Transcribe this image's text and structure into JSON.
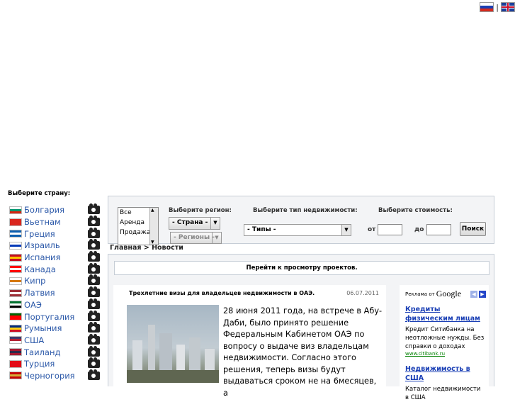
{
  "lang": {
    "ru": "RU",
    "separator": "|",
    "en": "EN"
  },
  "sidebar": {
    "heading": "Выберите страну:",
    "countries": [
      {
        "name": "Болгария",
        "colors": [
          "#ffffff",
          "#00966e",
          "#d62612"
        ]
      },
      {
        "name": "Вьетнам",
        "colors": [
          "#da251d",
          "#da251d",
          "#da251d"
        ]
      },
      {
        "name": "Греция",
        "colors": [
          "#0d5eaf",
          "#ffffff",
          "#0d5eaf"
        ]
      },
      {
        "name": "Израиль",
        "colors": [
          "#ffffff",
          "#0038b8",
          "#ffffff"
        ]
      },
      {
        "name": "Испания",
        "colors": [
          "#c60b1e",
          "#ffc400",
          "#c60b1e"
        ]
      },
      {
        "name": "Канада",
        "colors": [
          "#ff0000",
          "#ffffff",
          "#ff0000"
        ]
      },
      {
        "name": "Кипр",
        "colors": [
          "#ffffff",
          "#d57800",
          "#ffffff"
        ]
      },
      {
        "name": "Латвия",
        "colors": [
          "#9e3039",
          "#ffffff",
          "#9e3039"
        ]
      },
      {
        "name": "ОАЭ",
        "colors": [
          "#00732f",
          "#ffffff",
          "#000000"
        ]
      },
      {
        "name": "Португалия",
        "colors": [
          "#006600",
          "#ff0000",
          "#ff0000"
        ]
      },
      {
        "name": "Румыния",
        "colors": [
          "#002b7f",
          "#fcd116",
          "#ce1126"
        ]
      },
      {
        "name": "США",
        "colors": [
          "#3c3b6e",
          "#b22234",
          "#ffffff"
        ]
      },
      {
        "name": "Таиланд",
        "colors": [
          "#a51931",
          "#2d2a4a",
          "#a51931"
        ]
      },
      {
        "name": "Турция",
        "colors": [
          "#e30a17",
          "#e30a17",
          "#e30a17"
        ]
      },
      {
        "name": "Черногория",
        "colors": [
          "#c40308",
          "#d4af3a",
          "#c40308"
        ]
      }
    ]
  },
  "search": {
    "deal_options": [
      "Все",
      "Аренда",
      "Продажа"
    ],
    "region_label": "Выберите регион:",
    "country_select": "- Страна -",
    "regions_select": "- Регионы -",
    "type_label": "Выберите тип недвижимости:",
    "type_select": "- Типы -",
    "price_label": "Выберите стоимость:",
    "from_label": "от",
    "to_label": "до",
    "from_value": "",
    "to_value": "",
    "search_button": "Поиск"
  },
  "breadcrumb": "Главная > Новости",
  "projects_link": "Перейти к просмотру проектов.",
  "news": {
    "title": "Трехлетние визы для владельцев недвижимости в ОАЭ.",
    "date": "06.07.2011",
    "text": "28 июня  2011 года, на встрече в Абу-Даби, было принято решение Федеральным Кабинетом ОАЭ по вопросу о выдаче виз владельцам недвижимости. Согласно этого решения, теперь визы будут выдаваться сроком не на  6месяцев, а"
  },
  "ads": {
    "header": "Реклама от",
    "brand": "Google",
    "items": [
      {
        "title": "Кредиты физическим лицам",
        "desc": "Кредит Ситибанка на неотложные нужды. Без справки о доходах",
        "url": "www.citibank.ru"
      },
      {
        "title": "Недвижимость в США",
        "desc": "Каталог недвижимости в США"
      }
    ]
  }
}
